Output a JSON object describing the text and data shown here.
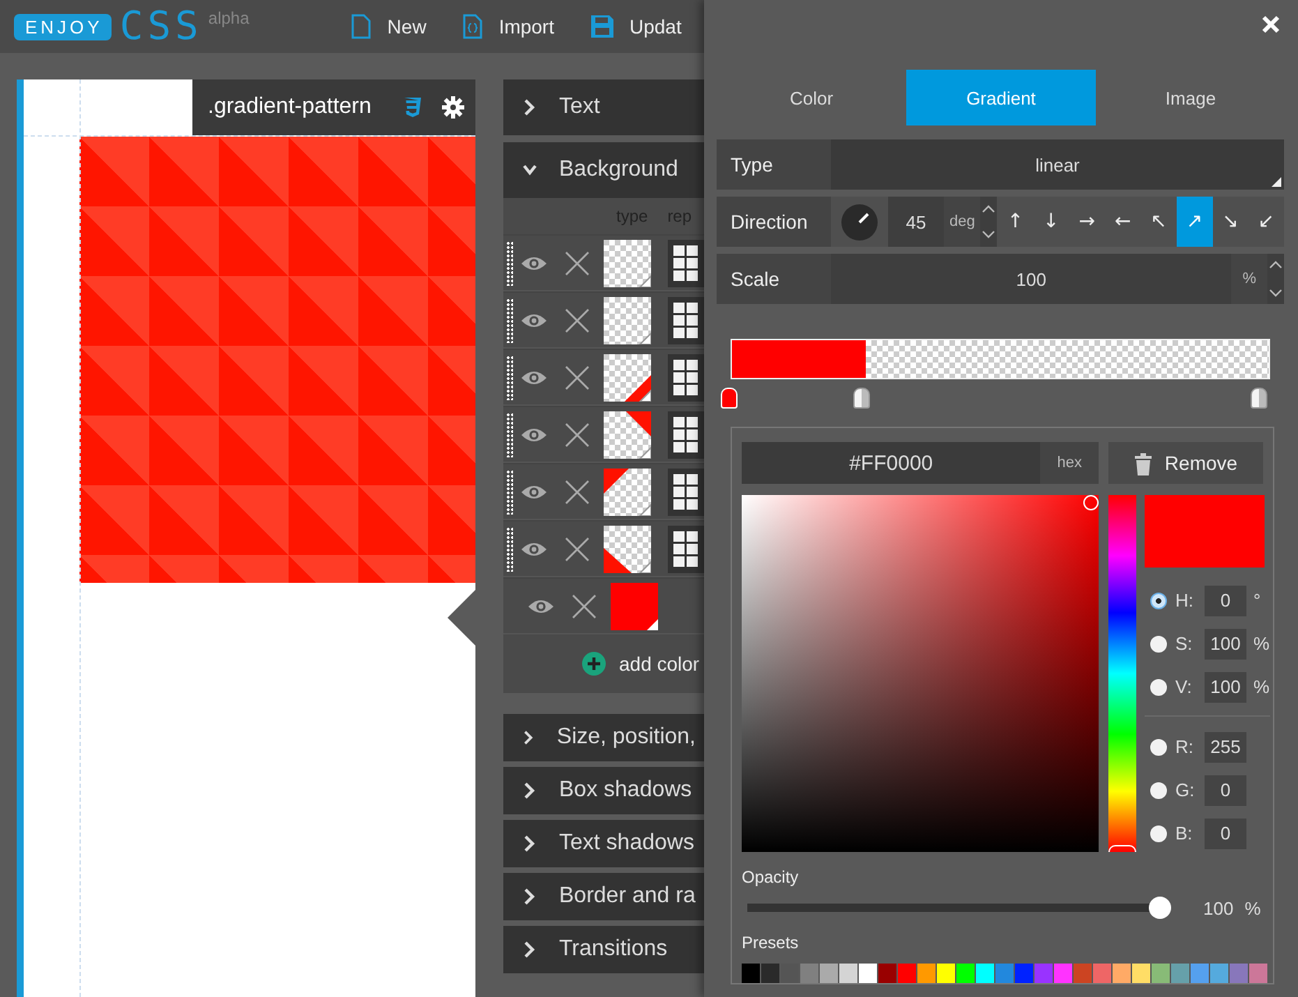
{
  "header": {
    "logo_badge": "ENJOY",
    "logo_text": "CSS",
    "logo_tag": "alpha",
    "menu": [
      {
        "label": "New"
      },
      {
        "label": "Import"
      },
      {
        "label": "Updat"
      }
    ]
  },
  "preview": {
    "selector": ".gradient-pattern"
  },
  "sections": [
    {
      "title": "Text",
      "expanded": false
    },
    {
      "title": "Background",
      "expanded": true
    },
    {
      "title": "Size, position,",
      "expanded": false
    },
    {
      "title": "Box shadows",
      "expanded": false
    },
    {
      "title": "Text shadows",
      "expanded": false
    },
    {
      "title": "Border and ra",
      "expanded": false
    },
    {
      "title": "Transitions",
      "expanded": false
    }
  ],
  "background": {
    "columns": [
      "type",
      "rep"
    ],
    "add_label": "add color",
    "layers": [
      {
        "kind": "blank"
      },
      {
        "kind": "blank"
      },
      {
        "kind": "corner-br"
      },
      {
        "kind": "corner-tr"
      },
      {
        "kind": "corner-tl"
      },
      {
        "kind": "corner-bl"
      },
      {
        "kind": "solid"
      }
    ]
  },
  "panel": {
    "tabs": [
      {
        "label": "Color",
        "selected": false
      },
      {
        "label": "Gradient",
        "selected": true
      },
      {
        "label": "Image",
        "selected": false
      }
    ],
    "type": {
      "label": "Type",
      "value": "linear"
    },
    "direction": {
      "label": "Direction",
      "value": "45",
      "unit": "deg",
      "arrows": [
        {
          "glyph": "↑",
          "selected": false
        },
        {
          "glyph": "↓",
          "selected": false
        },
        {
          "glyph": "→",
          "selected": false
        },
        {
          "glyph": "←",
          "selected": false
        },
        {
          "glyph": "↖",
          "selected": false
        },
        {
          "glyph": "↗",
          "selected": true
        },
        {
          "glyph": "↘",
          "selected": false
        },
        {
          "glyph": "↙",
          "selected": false
        }
      ]
    },
    "scale": {
      "label": "Scale",
      "value": "100",
      "unit": "%"
    },
    "stops": [
      {
        "level": 0,
        "selected": true
      },
      {
        "level": 0.25,
        "selected": false
      },
      {
        "level": 1,
        "selected": false
      }
    ],
    "picker": {
      "hex": "#FF0000",
      "hex_label": "hex",
      "remove": "Remove",
      "color": "#ff0000",
      "hue": {
        "level": 0
      },
      "channels": [
        {
          "label": "H:",
          "value": "0",
          "unit": "°",
          "selected": true
        },
        {
          "label": "S:",
          "value": "100",
          "unit": "%",
          "selected": false
        },
        {
          "label": "V:",
          "value": "100",
          "unit": "%",
          "selected": false
        },
        {
          "label": "R:",
          "value": "255",
          "selected": false
        },
        {
          "label": "G:",
          "value": "0",
          "selected": false
        },
        {
          "label": "B:",
          "value": "0",
          "selected": false
        }
      ],
      "opacity_label": "Opacity",
      "opacity": {
        "level": 1,
        "reading": "100",
        "unit": "%"
      },
      "presets_label": "Presets",
      "presets": [
        {
          "color": "#000000"
        },
        {
          "color": "#2a2a2a"
        },
        {
          "color": "#555555"
        },
        {
          "color": "#808080"
        },
        {
          "color": "#aaaaaa"
        },
        {
          "color": "#d4d4d4"
        },
        {
          "color": "#ffffff"
        },
        {
          "color": "#990000"
        },
        {
          "color": "#ff0000"
        },
        {
          "color": "#ff9900"
        },
        {
          "color": "#ffff00"
        },
        {
          "color": "#00ff00"
        },
        {
          "color": "#00ffff"
        },
        {
          "color": "#2288dd"
        },
        {
          "color": "#0022ff"
        },
        {
          "color": "#9933ff"
        },
        {
          "color": "#ff33ff"
        },
        {
          "color": "#cc4422"
        },
        {
          "color": "#ee6666"
        },
        {
          "color": "#ffaa66"
        },
        {
          "color": "#ffdd66"
        },
        {
          "color": "#88bb77"
        },
        {
          "color": "#66a0aa"
        },
        {
          "color": "#55a0ee"
        },
        {
          "color": "#55aadd"
        },
        {
          "color": "#8877bb"
        },
        {
          "color": "#cc7799"
        }
      ]
    }
  }
}
